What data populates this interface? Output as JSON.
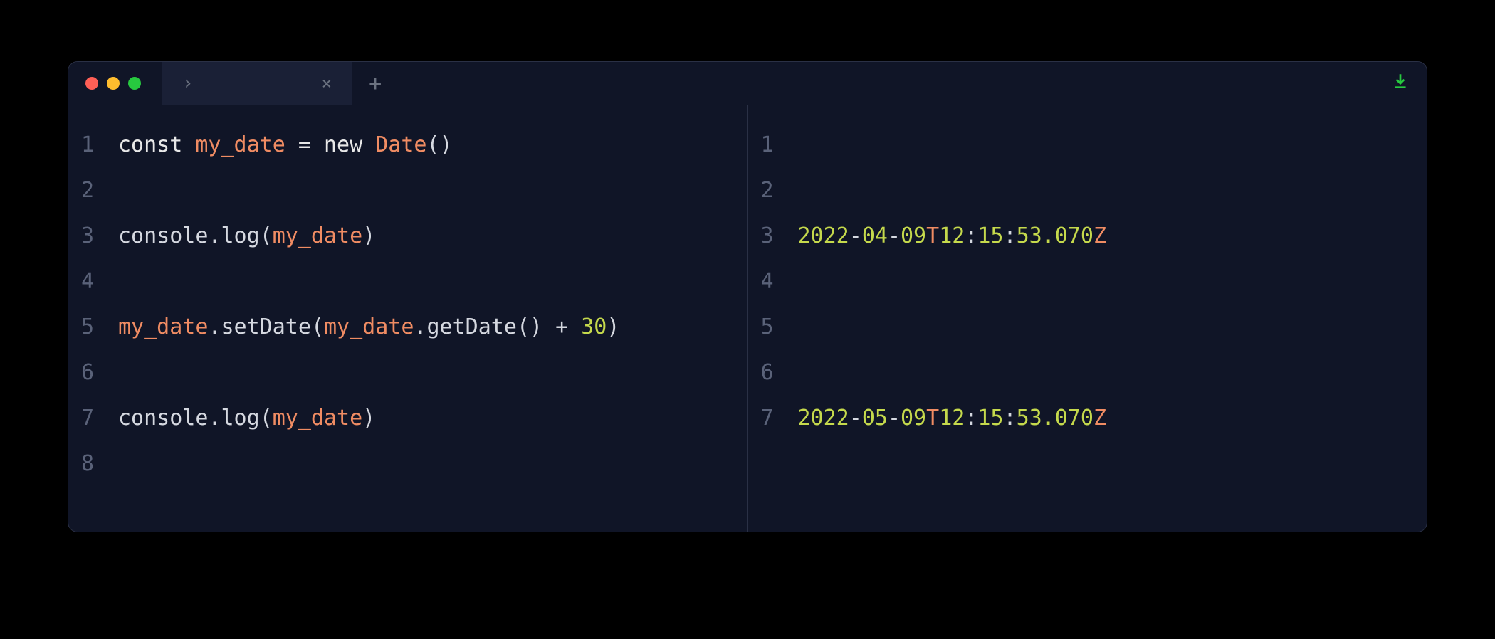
{
  "tab": {
    "label": "›",
    "close": "×"
  },
  "newTab": "+",
  "leftPane": {
    "lines": [
      {
        "num": "1",
        "tokens": [
          {
            "t": "const ",
            "c": "kw"
          },
          {
            "t": "my_date",
            "c": "var"
          },
          {
            "t": " ",
            "c": "op"
          },
          {
            "t": "=",
            "c": "op"
          },
          {
            "t": " ",
            "c": "op"
          },
          {
            "t": "new ",
            "c": "kw"
          },
          {
            "t": "Date",
            "c": "class"
          },
          {
            "t": "()",
            "c": "paren"
          }
        ]
      },
      {
        "num": "2",
        "tokens": []
      },
      {
        "num": "3",
        "tokens": [
          {
            "t": "console",
            "c": "obj"
          },
          {
            "t": ".",
            "c": "dot"
          },
          {
            "t": "log",
            "c": "method"
          },
          {
            "t": "(",
            "c": "paren"
          },
          {
            "t": "my_date",
            "c": "var"
          },
          {
            "t": ")",
            "c": "paren"
          }
        ]
      },
      {
        "num": "4",
        "tokens": []
      },
      {
        "num": "5",
        "tokens": [
          {
            "t": "my_date",
            "c": "var"
          },
          {
            "t": ".",
            "c": "dot"
          },
          {
            "t": "setDate",
            "c": "method"
          },
          {
            "t": "(",
            "c": "paren"
          },
          {
            "t": "my_date",
            "c": "var"
          },
          {
            "t": ".",
            "c": "dot"
          },
          {
            "t": "getDate",
            "c": "method"
          },
          {
            "t": "()",
            "c": "paren"
          },
          {
            "t": " ",
            "c": "plus"
          },
          {
            "t": "+",
            "c": "plus"
          },
          {
            "t": " ",
            "c": "plus"
          },
          {
            "t": "30",
            "c": "num"
          },
          {
            "t": ")",
            "c": "paren"
          }
        ]
      },
      {
        "num": "6",
        "tokens": []
      },
      {
        "num": "7",
        "tokens": [
          {
            "t": "console",
            "c": "obj"
          },
          {
            "t": ".",
            "c": "dot"
          },
          {
            "t": "log",
            "c": "method"
          },
          {
            "t": "(",
            "c": "paren"
          },
          {
            "t": "my_date",
            "c": "var"
          },
          {
            "t": ")",
            "c": "paren"
          }
        ]
      },
      {
        "num": "8",
        "tokens": []
      }
    ]
  },
  "rightPane": {
    "lines": [
      {
        "num": "1",
        "tokens": []
      },
      {
        "num": "2",
        "tokens": []
      },
      {
        "num": "3",
        "tokens": [
          {
            "t": "2022",
            "c": "date-part"
          },
          {
            "t": "-",
            "c": "dash"
          },
          {
            "t": "04",
            "c": "date-part"
          },
          {
            "t": "-",
            "c": "dash"
          },
          {
            "t": "09",
            "c": "date-part"
          },
          {
            "t": "T",
            "c": "t-char"
          },
          {
            "t": "12",
            "c": "date-part"
          },
          {
            "t": ":",
            "c": "colon"
          },
          {
            "t": "15",
            "c": "date-part"
          },
          {
            "t": ":",
            "c": "colon"
          },
          {
            "t": "53.070",
            "c": "date-part"
          },
          {
            "t": "Z",
            "c": "z-char"
          }
        ]
      },
      {
        "num": "4",
        "tokens": []
      },
      {
        "num": "5",
        "tokens": []
      },
      {
        "num": "6",
        "tokens": []
      },
      {
        "num": "7",
        "tokens": [
          {
            "t": "2022",
            "c": "date-part"
          },
          {
            "t": "-",
            "c": "dash"
          },
          {
            "t": "05",
            "c": "date-part"
          },
          {
            "t": "-",
            "c": "dash"
          },
          {
            "t": "09",
            "c": "date-part"
          },
          {
            "t": "T",
            "c": "t-char"
          },
          {
            "t": "12",
            "c": "date-part"
          },
          {
            "t": ":",
            "c": "colon"
          },
          {
            "t": "15",
            "c": "date-part"
          },
          {
            "t": ":",
            "c": "colon"
          },
          {
            "t": "53.070",
            "c": "date-part"
          },
          {
            "t": "Z",
            "c": "z-char"
          }
        ]
      }
    ]
  }
}
